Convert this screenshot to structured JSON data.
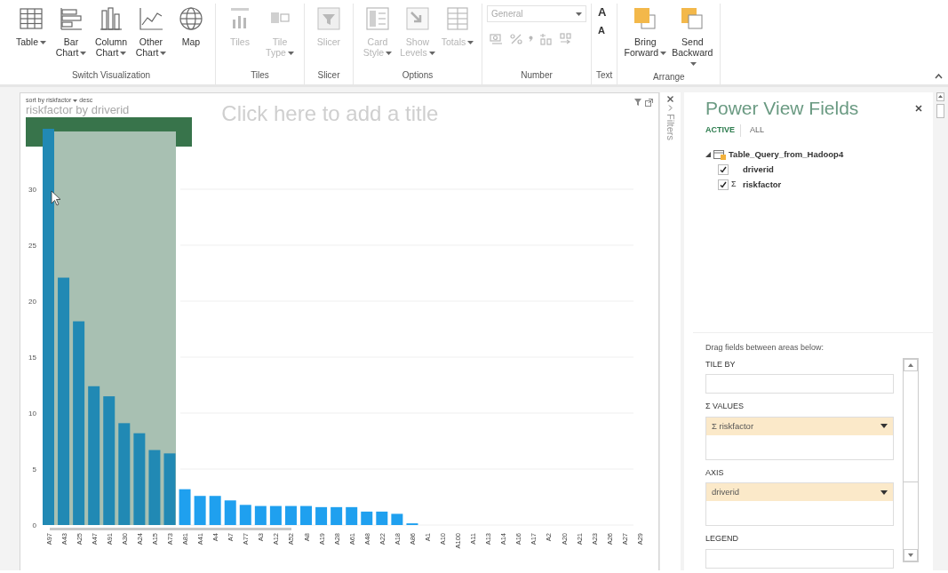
{
  "ribbon": {
    "groups": [
      {
        "kind": "large",
        "label": "Switch Visualization",
        "buttons": [
          {
            "label": "Table",
            "dropdown": true,
            "disabled": false
          },
          {
            "label": "Bar Chart",
            "dropdown": true,
            "disabled": false
          },
          {
            "label": "Column Chart",
            "dropdown": true,
            "disabled": false
          },
          {
            "label": "Other Chart",
            "dropdown": true,
            "disabled": false
          },
          {
            "label": "Map",
            "dropdown": false,
            "disabled": false
          }
        ]
      },
      {
        "kind": "large",
        "label": "Tiles",
        "buttons": [
          {
            "label": "Tiles",
            "dropdown": false,
            "disabled": true
          },
          {
            "label": "Tile Type",
            "dropdown": true,
            "disabled": true
          }
        ]
      },
      {
        "kind": "large",
        "label": "Slicer",
        "buttons": [
          {
            "label": "Slicer",
            "dropdown": false,
            "disabled": true
          }
        ]
      },
      {
        "kind": "large",
        "label": "Options",
        "buttons": [
          {
            "label": "Card Style",
            "dropdown": true,
            "disabled": true
          },
          {
            "label": "Show Levels",
            "dropdown": true,
            "disabled": true
          },
          {
            "label": "Totals",
            "dropdown": true,
            "disabled": true
          }
        ]
      },
      {
        "kind": "number",
        "label": "Number",
        "combo": {
          "value": "General",
          "disabled": true
        },
        "small_buttons": [
          {
            "disabled": true
          },
          {
            "disabled": true
          },
          {
            "disabled": true
          },
          {
            "disabled": true
          },
          {
            "disabled": true
          }
        ]
      },
      {
        "kind": "font",
        "label": "Text",
        "text_buttons": [
          {
            "label": "A",
            "disabled": false
          },
          {
            "label": "A",
            "disabled": false
          }
        ]
      },
      {
        "kind": "large",
        "label": "Arrange",
        "buttons": [
          {
            "label": "Bring Forward",
            "dropdown": true,
            "disabled": false
          },
          {
            "label": "Send Backward",
            "dropdown": true,
            "disabled": false
          }
        ]
      }
    ]
  },
  "canvas": {
    "title_placeholder": "Click here to add a title",
    "chart": {
      "sort_label": "sort by riskfactor",
      "sort_order": "desc",
      "title": "riskfactor by driverid",
      "chart_data": {
        "type": "bar",
        "stacked": true,
        "grid": true,
        "categories": [
          "A97",
          "A43",
          "A25",
          "A47",
          "A91",
          "A30",
          "A24",
          "A15",
          "A73",
          "A81",
          "A41",
          "A4",
          "A7",
          "A77",
          "A3",
          "A12",
          "A52",
          "A8",
          "A19",
          "A28",
          "A61",
          "A48",
          "A22",
          "A18",
          "A86",
          "A1",
          "A10",
          "A100",
          "A11",
          "A13",
          "A14",
          "A16",
          "A17",
          "A2",
          "A20",
          "A21",
          "A23",
          "A26",
          "A27",
          "A29"
        ],
        "series": [
          {
            "color": "#2189b4",
            "values": [
              35.4,
              22.1,
              18.2,
              12.4,
              11.5,
              9.1,
              8.2,
              6.7,
              6.4,
              null,
              null,
              null,
              null,
              null,
              null,
              null,
              null,
              null,
              null,
              null,
              null,
              null,
              null,
              null,
              null,
              null,
              null,
              null,
              null,
              null,
              null,
              null,
              null,
              null,
              null,
              null,
              null,
              null,
              null,
              null
            ]
          },
          {
            "color": "#1fa0ef",
            "values": [
              null,
              null,
              null,
              null,
              null,
              null,
              null,
              null,
              null,
              3.2,
              2.6,
              2.6,
              2.2,
              1.8,
              1.7,
              1.7,
              1.7,
              1.7,
              1.6,
              1.6,
              1.6,
              1.2,
              1.2,
              1.0,
              0.15,
              0,
              0,
              0,
              0,
              0,
              0,
              0,
              0,
              0,
              0,
              0,
              0,
              0,
              0,
              0
            ]
          }
        ],
        "ylim": [
          0,
          35.4
        ],
        "yticks": [
          0,
          5,
          10,
          15,
          20,
          25,
          30
        ]
      }
    }
  },
  "filters_pane": {
    "label": "Filters"
  },
  "fields_pane": {
    "title": "Power View Fields",
    "tabs": [
      {
        "label": "ACTIVE",
        "selected": true
      },
      {
        "label": "ALL",
        "selected": false
      }
    ],
    "tables": [
      {
        "name": "Table_Query_from_Hadoop4",
        "expanded": true,
        "fields": [
          {
            "name": "driverid",
            "checked": true
          },
          {
            "name": "riskfactor",
            "prefix": "Σ",
            "checked": true
          }
        ]
      }
    ],
    "areas_hint": "Drag fields between areas below:",
    "areas": [
      {
        "label": "TILE BY"
      },
      {
        "label": "Σ VALUES",
        "items": [
          {
            "label": "Σ riskfactor"
          }
        ]
      },
      {
        "label": "AXIS",
        "items": [
          {
            "label": "driverid"
          }
        ]
      },
      {
        "label": "LEGEND"
      }
    ]
  }
}
